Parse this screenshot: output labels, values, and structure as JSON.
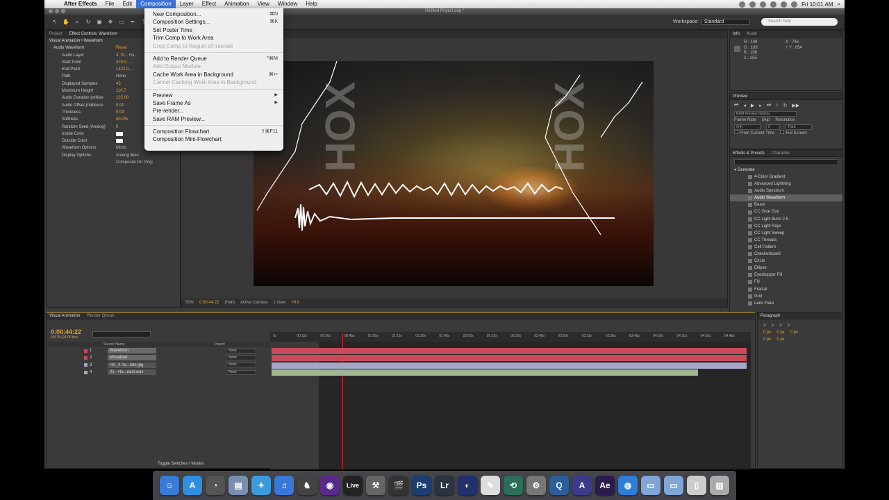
{
  "menubar": {
    "app_name": "After Effects",
    "items": [
      "File",
      "Edit",
      "Composition",
      "Layer",
      "Effect",
      "Animation",
      "View",
      "Window",
      "Help"
    ],
    "active_item": "Composition",
    "clock": "Fri 10:01 AM"
  },
  "window": {
    "doc_title": "Untitled Project.aep *",
    "workspace_label": "Workspace:",
    "workspace_value": "Standard",
    "search_placeholder": "Search Help"
  },
  "composition_menu": [
    {
      "label": "New Composition...",
      "shortcut": "⌘N",
      "enabled": true
    },
    {
      "label": "Composition Settings...",
      "shortcut": "⌘K",
      "enabled": true
    },
    {
      "label": "Set Poster Time",
      "shortcut": "",
      "enabled": true
    },
    {
      "label": "Trim Comp to Work Area",
      "shortcut": "",
      "enabled": true
    },
    {
      "label": "Crop Comp to Region of Interest",
      "shortcut": "",
      "enabled": false
    },
    {
      "sep": true
    },
    {
      "label": "Add to Render Queue",
      "shortcut": "^⌘M",
      "enabled": true
    },
    {
      "label": "Add Output Module",
      "shortcut": "",
      "enabled": false
    },
    {
      "label": "Cache Work Area in Background",
      "shortcut": "⌘↩",
      "enabled": true
    },
    {
      "label": "Cancel Caching Work Area in Background",
      "shortcut": "",
      "enabled": false
    },
    {
      "sep": true
    },
    {
      "label": "Preview",
      "shortcut": "",
      "enabled": true,
      "submenu": true
    },
    {
      "label": "Save Frame As",
      "shortcut": "",
      "enabled": true,
      "submenu": true
    },
    {
      "label": "Pre-render...",
      "shortcut": "",
      "enabled": true
    },
    {
      "label": "Save RAM Preview...",
      "shortcut": "",
      "enabled": true
    },
    {
      "sep": true
    },
    {
      "label": "Composition Flowchart",
      "shortcut": "⇧⌘F11",
      "enabled": true
    },
    {
      "label": "Composition Mini-Flowchart",
      "shortcut": "",
      "enabled": true
    }
  ],
  "effect_controls": {
    "tabs": [
      "Project",
      "Effect Controls: Waveform"
    ],
    "comp_line": "Visual Animation • Waveform",
    "effect_name": "Audio Waveform",
    "reset_label": "Reset",
    "rows": [
      {
        "label": "Audio Layer",
        "value": "4. 01 - Ha..."
      },
      {
        "label": "Start Point",
        "value": "478.0, ..."
      },
      {
        "label": "End Point",
        "value": "1432.0, ..."
      },
      {
        "label": "Path",
        "value": "None"
      },
      {
        "label": "Displayed Samples",
        "value": "43"
      },
      {
        "label": "Maximum Height",
        "value": "110.7"
      },
      {
        "label": "Audio Duration (millise",
        "value": "125.00"
      },
      {
        "label": "Audio Offset (milliseco",
        "value": "0.00"
      },
      {
        "label": "Thickness",
        "value": "9.03"
      },
      {
        "label": "Softness",
        "value": "50.0%"
      },
      {
        "label": "Random Seed (Analog)",
        "value": "0"
      },
      {
        "label": "Inside Color",
        "value": ""
      },
      {
        "label": "Outside Color",
        "value": ""
      },
      {
        "label": "Waveform Options",
        "value": "Mono"
      },
      {
        "label": "Display Options",
        "value": "Analog lines"
      },
      {
        "label": "",
        "value": "Composite On Origi"
      }
    ]
  },
  "viewer": {
    "zoom": "50%",
    "timecode": "0:00:44:22",
    "resolution": "(Half)",
    "camera": "Active Camera",
    "views": "1 View",
    "exposure": "+0.0",
    "logo_text": "HOX"
  },
  "info_panel": {
    "tabs": [
      "Info",
      "Audio"
    ],
    "r": "R : 109",
    "g": "G : 109",
    "b": "B : 108",
    "a": "A : 255",
    "x": "X : 746",
    "y": "+ Y : 654"
  },
  "preview_panel": {
    "tab": "Preview",
    "ram_options": "RAM Preview Options",
    "frame_rate_label": "Frame Rate",
    "skip_label": "Skip",
    "resolution_label": "Resolution",
    "frame_rate_value": "(24)",
    "skip_value": "0",
    "resolution_value": "Third",
    "from_current": "From Current Time",
    "full_screen": "Full Screen"
  },
  "effects_presets": {
    "tabs": [
      "Effects & Presets",
      "Character"
    ],
    "category": "Generate",
    "items": [
      "4-Color Gradient",
      "Advanced Lightning",
      "Audio Spectrum",
      "Audio Waveform",
      "Beam",
      "CC Glue Gun",
      "CC Light Burst 2.5",
      "CC Light Rays",
      "CC Light Sweep",
      "CC Threads",
      "Cell Pattern",
      "Checkerboard",
      "Circle",
      "Ellipse",
      "Eyedropper Fill",
      "Fill",
      "Fractal",
      "Grid",
      "Lens Flare"
    ],
    "selected": "Audio Waveform"
  },
  "timeline": {
    "tabs": [
      "Visual Animation",
      "Render Queue"
    ],
    "current_time": "0:00:44:22",
    "frames": "01078 (24.00 fps)",
    "col_source": "Source Name",
    "col_parent": "Parent",
    "ruler": [
      "0s",
      "00:15s",
      "00:30s",
      "00:45s",
      "01:00s",
      "01:15s",
      "01:30s",
      "01:45s",
      "02:00s",
      "02:15s",
      "02:30s",
      "02:45s",
      "03:00s",
      "03:15s",
      "03:30s",
      "03:45s",
      "04:00s",
      "04:15s",
      "04:30s",
      "04:45s"
    ],
    "layers": [
      {
        "num": "1",
        "name": "Waveform",
        "parent": "None",
        "label_color": "#c94b5a",
        "bar_color": "#c94b5a"
      },
      {
        "num": "2",
        "name": "Visualizer",
        "parent": "None",
        "label_color": "#c94b5a",
        "bar_color": "#c94b5a"
      },
      {
        "num": "3",
        "name": "HA_X Yo...late.jpg",
        "parent": "None",
        "label_color": "#a7a6c8",
        "bar_color": "#a7a6c8"
      },
      {
        "num": "4",
        "name": "01 - Ha...east.wav",
        "parent": "None",
        "label_color": "#9fb794",
        "bar_color": "#9fb794"
      }
    ],
    "toggle_label": "Toggle Switches / Modes"
  },
  "paragraph_panel": {
    "tab": "Paragraph",
    "values": [
      "0 px",
      "0 px",
      "0 px",
      "0 px",
      "0 px"
    ]
  },
  "dock": {
    "icons": [
      {
        "name": "finder-icon",
        "glyph": "☺",
        "color": "#3a7bd5"
      },
      {
        "name": "app-store-icon",
        "glyph": "A",
        "color": "#2f8fe3"
      },
      {
        "name": "dashboard-icon",
        "glyph": "◔",
        "color": "#555"
      },
      {
        "name": "preview-icon",
        "glyph": "▤",
        "color": "#7a8fb0"
      },
      {
        "name": "safari-icon",
        "glyph": "✦",
        "color": "#3b9cdc"
      },
      {
        "name": "itunes-icon",
        "glyph": "♫",
        "color": "#3a78d8"
      },
      {
        "name": "chess-icon",
        "glyph": "♞",
        "color": "#444"
      },
      {
        "name": "pro-tools-icon",
        "glyph": "◉",
        "color": "#5a2a8a"
      },
      {
        "name": "ableton-live-icon",
        "glyph": "Live",
        "color": "#222"
      },
      {
        "name": "utility-icon",
        "glyph": "⚒",
        "color": "#666"
      },
      {
        "name": "final-cut-icon",
        "glyph": "🎬",
        "color": "#333"
      },
      {
        "name": "photoshop-icon",
        "glyph": "Ps",
        "color": "#1c3d6e"
      },
      {
        "name": "lightroom-icon",
        "glyph": "Lr",
        "color": "#2b3440"
      },
      {
        "name": "cinema-4d-icon",
        "glyph": "◐",
        "color": "#23306b"
      },
      {
        "name": "textedit-icon",
        "glyph": "✎",
        "color": "#ddd"
      },
      {
        "name": "time-machine-icon",
        "glyph": "⟲",
        "color": "#2c6e5a"
      },
      {
        "name": "system-prefs-icon",
        "glyph": "⚙",
        "color": "#777"
      },
      {
        "name": "quicktime-icon",
        "glyph": "Q",
        "color": "#2d5e9a"
      },
      {
        "name": "maya-icon",
        "glyph": "A",
        "color": "#3b3b8a"
      },
      {
        "name": "after-effects-icon",
        "glyph": "Ae",
        "color": "#2b1b4a"
      },
      {
        "name": "globe-icon",
        "glyph": "◍",
        "color": "#2e7ed8"
      },
      {
        "name": "folder-icon",
        "glyph": "▭",
        "color": "#7fa6d6"
      },
      {
        "name": "downloads-folder-icon",
        "glyph": "▭",
        "color": "#7fa6d6"
      },
      {
        "name": "document-icon",
        "glyph": "▯",
        "color": "#ccc"
      },
      {
        "name": "trash-icon",
        "glyph": "▥",
        "color": "#aaa"
      }
    ]
  }
}
